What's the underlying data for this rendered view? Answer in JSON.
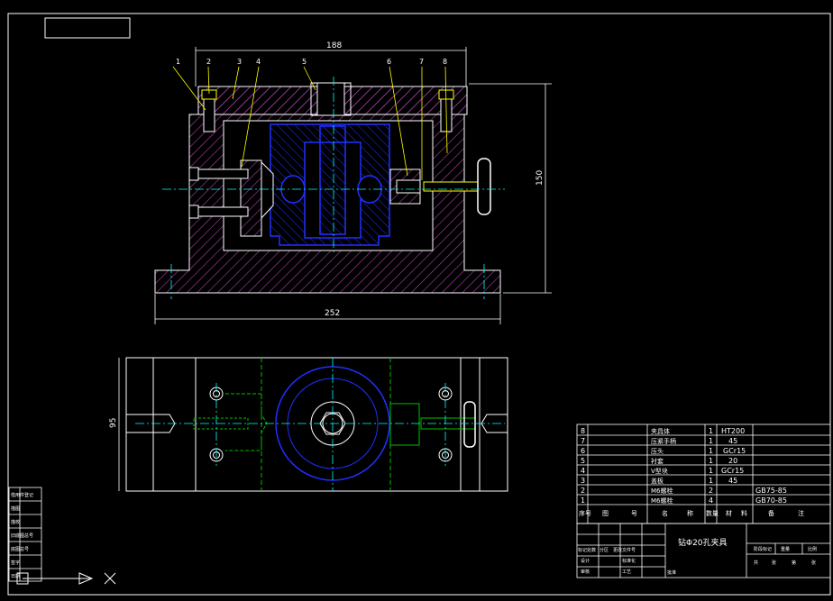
{
  "dimensions": {
    "top_width": "188",
    "height": "150",
    "bottom_width": "252",
    "plan_depth": "95"
  },
  "balloons": [
    "1",
    "2",
    "3",
    "4",
    "5",
    "6",
    "7",
    "8"
  ],
  "bom": {
    "rows": [
      {
        "no": "8",
        "name": "夹具体",
        "qty": "1",
        "material": "HT200",
        "note": ""
      },
      {
        "no": "7",
        "name": "压紧手柄",
        "qty": "1",
        "material": "45",
        "note": ""
      },
      {
        "no": "6",
        "name": "压头",
        "qty": "1",
        "material": "GCr15",
        "note": ""
      },
      {
        "no": "5",
        "name": "衬套",
        "qty": "1",
        "material": "20",
        "note": ""
      },
      {
        "no": "4",
        "name": "V型块",
        "qty": "1",
        "material": "GCr15",
        "note": ""
      },
      {
        "no": "3",
        "name": "盖板",
        "qty": "1",
        "material": "45",
        "note": ""
      },
      {
        "no": "2",
        "name": "M6螺栓",
        "qty": "2",
        "material": "",
        "note": "GB75-85"
      },
      {
        "no": "1",
        "name": "M6螺栓",
        "qty": "4",
        "material": "",
        "note": "GB70-85"
      }
    ],
    "header": [
      "序号",
      "图",
      "号",
      "名",
      "称",
      "数量",
      "材",
      "料",
      "备",
      "注"
    ]
  },
  "title_block": {
    "drawing_title": "钻Φ20孔夹具",
    "left_labels": [
      "标记",
      "处数",
      "分区",
      "更改文件号",
      "设计",
      "标准化",
      "审核",
      "工艺"
    ],
    "right_labels": [
      "阶段标记",
      "重量",
      "比例",
      "共",
      "张",
      "第",
      "张"
    ],
    "bottom_label": "批准"
  },
  "left_panel": {
    "labels": [
      "借用件登记",
      "描图",
      "描校",
      "旧底图总号",
      "底图总号",
      "签字",
      "日期"
    ]
  },
  "colors": {
    "outline": "#ffffff",
    "hatch": "#b040b0",
    "part": "#0000ff",
    "centerline": "#00ffff",
    "hidden": "#00c000",
    "dimension": "#ffffff",
    "leader": "#ffff00",
    "frame": "#ffffff"
  }
}
